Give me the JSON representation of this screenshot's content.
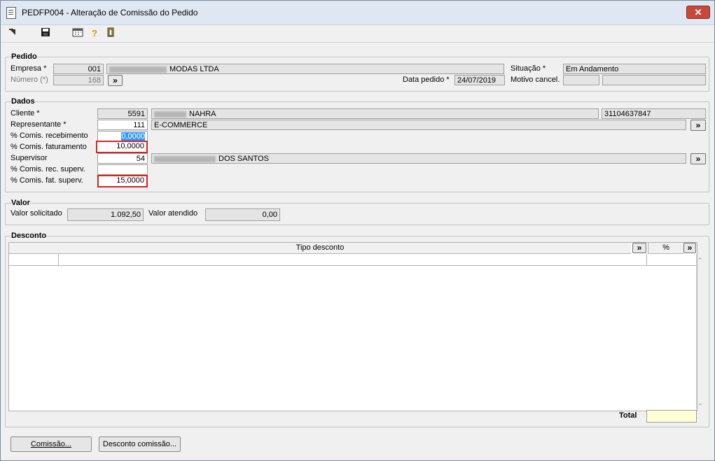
{
  "window": {
    "title": "PEDFP004 - Alteração de Comissão do Pedido",
    "close_label": "✕"
  },
  "toolbar": {
    "icons": [
      "arrow-icon",
      "save-icon",
      "calendar-icon",
      "help-icon",
      "exit-door-icon"
    ]
  },
  "pedido": {
    "legend": "Pedido",
    "empresa_label": "Empresa *",
    "empresa_code": "001",
    "empresa_name": "MODAS LTDA",
    "numero_label": "Número (*)",
    "numero_value": "168",
    "expand_label": "»",
    "data_pedido_label": "Data pedido *",
    "data_pedido_value": "24/07/2019",
    "situacao_label": "Situação *",
    "situacao_value": "Em Andamento",
    "motivo_label": "Motivo cancel."
  },
  "dados": {
    "legend": "Dados",
    "cliente_label": "Cliente *",
    "cliente_code": "5591",
    "cliente_name": "NAHRA",
    "cliente_doc": "31104637847",
    "representante_label": "Representante *",
    "representante_code": "111",
    "representante_name": "E-COMMERCE",
    "comis_receb_label": "% Comis. recebimento",
    "comis_receb_value": "0,0000",
    "comis_fat_label": "% Comis. faturamento",
    "comis_fat_value": "10,0000",
    "supervisor_label": "Supervisor",
    "supervisor_code": "54",
    "supervisor_name": "DOS SANTOS",
    "comis_rec_superv_label": "% Comis. rec. superv.",
    "comis_fat_superv_label": "% Comis. fat. superv.",
    "comis_fat_superv_value": "15,0000"
  },
  "valor": {
    "legend": "Valor",
    "solicitado_label": "Valor solicitado",
    "solicitado_value": "1.092,50",
    "atendido_label": "Valor atendido",
    "atendido_value": "0,00"
  },
  "desconto": {
    "legend": "Desconto",
    "col_tipo": "Tipo desconto",
    "col_pct": "%",
    "total_label": "Total"
  },
  "buttons": {
    "comissao": "Comissão...",
    "desconto_comissao": "Desconto comissão..."
  }
}
